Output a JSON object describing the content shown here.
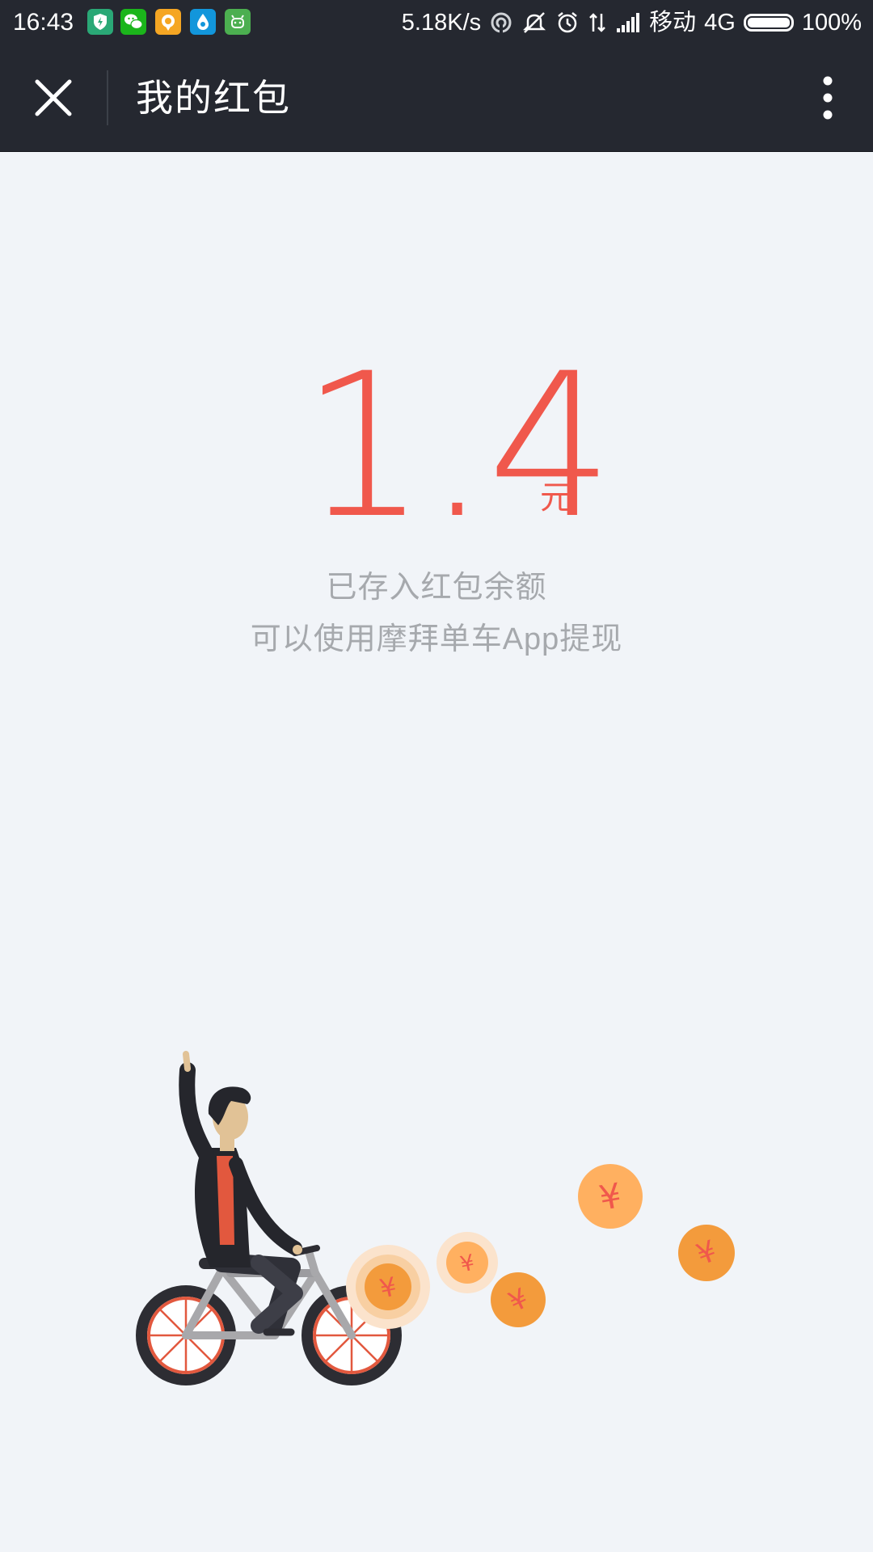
{
  "status_bar": {
    "time": "16:43",
    "network_speed": "5.18K/s",
    "carrier": "移动",
    "network_type": "4G",
    "battery": "100%",
    "app_icons": [
      {
        "name": "shield-app-icon",
        "color": "#2aa876"
      },
      {
        "name": "wechat-icon",
        "color": "#1bb51b"
      },
      {
        "name": "chat-bubble-app-icon",
        "color": "#f5a623"
      },
      {
        "name": "water-drop-app-icon",
        "color": "#1296db"
      },
      {
        "name": "android-app-icon",
        "color": "#4caf50"
      }
    ],
    "status_icons": [
      "hotspot-icon",
      "mute-icon",
      "alarm-icon",
      "data-transfer-icon",
      "signal-icon",
      "battery-icon"
    ]
  },
  "header": {
    "title": "我的红包",
    "close_icon": "close-icon",
    "more_icon": "more-vertical-icon"
  },
  "balance": {
    "amount": "1.4",
    "unit": "元",
    "line1": "已存入红包余额",
    "line2": "可以使用摩拜单车App提现"
  },
  "illustration": {
    "description_icon": "cyclist-with-coins-illustration",
    "coin_symbol": "¥",
    "colors": {
      "accent": "#f0584c",
      "coin": "#f39b3c",
      "coin_light": "#ffb060",
      "background": "#f1f4f8",
      "bar": "#252830"
    }
  }
}
